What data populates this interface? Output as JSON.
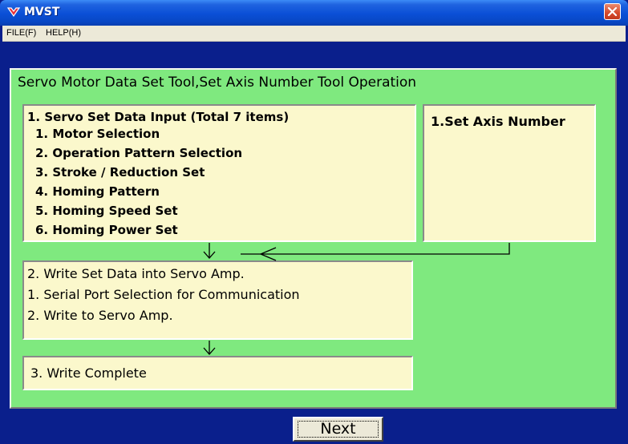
{
  "window": {
    "title": "MVST",
    "icon": "mvst-app-icon",
    "close_icon": "close-x-icon",
    "accent_color": "#0a4fd6",
    "close_color": "#d5492b"
  },
  "menu": {
    "items": [
      "FILE(F)",
      "HELP(H)"
    ]
  },
  "panel": {
    "title": "Servo Motor Data Set Tool,Set Axis Number Tool Operation",
    "background": "#7fe97f",
    "box_background": "#fbf8cc",
    "step1": {
      "heading": "1. Servo Set Data Input (Total 7 items)",
      "items": [
        "1. Motor Selection",
        "2. Operation Pattern Selection",
        "3. Stroke / Reduction Set",
        "4. Homing Pattern",
        "5. Homing Speed Set",
        "6. Homing Power Set"
      ]
    },
    "axis": {
      "heading": "1.Set Axis Number"
    },
    "step2": {
      "heading": "2. Write Set Data into Servo Amp.",
      "items": [
        "1. Serial Port Selection for Communication",
        "2. Write to Servo Amp."
      ]
    },
    "step3": {
      "heading": "3. Write Complete"
    }
  },
  "footer": {
    "next_label": "Next",
    "background": "#0a1f8c"
  }
}
